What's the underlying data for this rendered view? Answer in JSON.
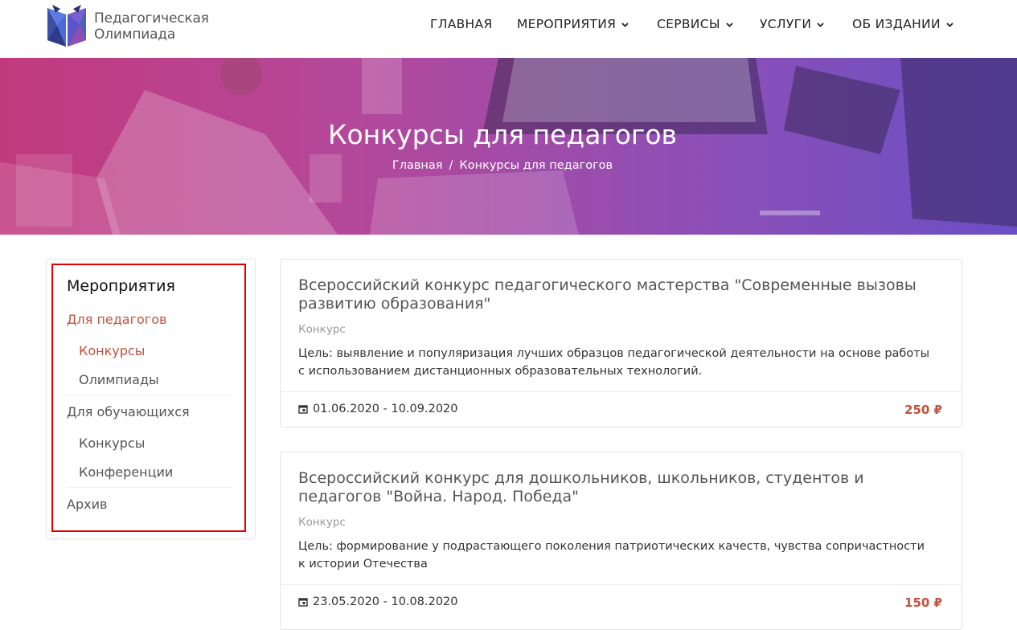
{
  "header": {
    "logo_line1": "Педагогическая",
    "logo_line2": "Олимпиада",
    "nav": [
      {
        "label": "ГЛАВНАЯ"
      },
      {
        "label": "МЕРОПРИЯТИЯ"
      },
      {
        "label": "СЕРВИСЫ"
      },
      {
        "label": "УСЛУГИ"
      },
      {
        "label": "ОБ ИЗДАНИИ"
      }
    ]
  },
  "hero": {
    "title": "Конкурсы для педагогов",
    "breadcrumb": {
      "home": "Главная",
      "separator": "/",
      "current": "Конкурсы для педагогов"
    }
  },
  "sidebar": {
    "title": "Мероприятия",
    "items": [
      {
        "label": "Для педагогов"
      },
      {
        "label": "Конкурсы"
      },
      {
        "label": "Олимпиады"
      },
      {
        "label": "Для обучающихся"
      },
      {
        "label": "Конкурсы"
      },
      {
        "label": "Конференции"
      },
      {
        "label": "Архив"
      }
    ]
  },
  "events": [
    {
      "title": "Всероссийский конкурс педагогического мастерства \"Современные вызовы развитию образования\"",
      "type": "Конкурс",
      "description": "Цель: выявление и популяризация лучших образцов педагогической деятельности на основе работы с использованием дистанционных образовательных технологий.",
      "dates": "01.06.2020 - 10.09.2020",
      "price": "250 ₽"
    },
    {
      "title": "Всероссийский конкурс для дошкольников, школьников, студентов и педагогов \"Война. Народ. Победа\"",
      "type": "Конкурс",
      "description": "Цель: формирование у подрастающего поколения патриотических качеств, чувства сопричастности к истории Отечества",
      "dates": "23.05.2020 - 10.08.2020",
      "price": "150 ₽"
    }
  ],
  "colors": {
    "accent": "#c0533e",
    "highlight_border": "#e00000",
    "hero_start": "#c23a7e",
    "hero_end": "#6a4fc4"
  }
}
